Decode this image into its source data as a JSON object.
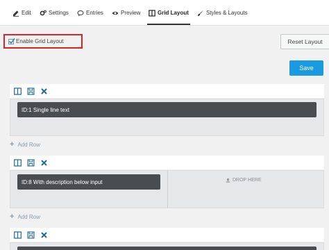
{
  "tabs": [
    {
      "label": "Edit",
      "icon": "edit-icon"
    },
    {
      "label": "Settings",
      "icon": "settings-icon"
    },
    {
      "label": "Entries",
      "icon": "entries-icon"
    },
    {
      "label": "Preview",
      "icon": "preview-icon"
    },
    {
      "label": "Grid Layout",
      "icon": "grid-layout-icon",
      "active": true
    },
    {
      "label": "Styles & Layouts",
      "icon": "brush-icon"
    }
  ],
  "enable_grid": {
    "label": "Enable Grid Layout",
    "checked": true
  },
  "buttons": {
    "reset": "Reset Layout",
    "save": "Save"
  },
  "rows": [
    {
      "fields": [
        "ID:1 Single line text"
      ]
    },
    {
      "fields": [
        "ID:8 With description below input"
      ],
      "drop_label": "DROP HERE"
    },
    {
      "fields": [
        ""
      ]
    }
  ],
  "add_row_label": "Add Row",
  "colors": {
    "accent": "#1a9ae0",
    "highlight": "#d9252a",
    "field_bg": "#4a4d4f"
  }
}
